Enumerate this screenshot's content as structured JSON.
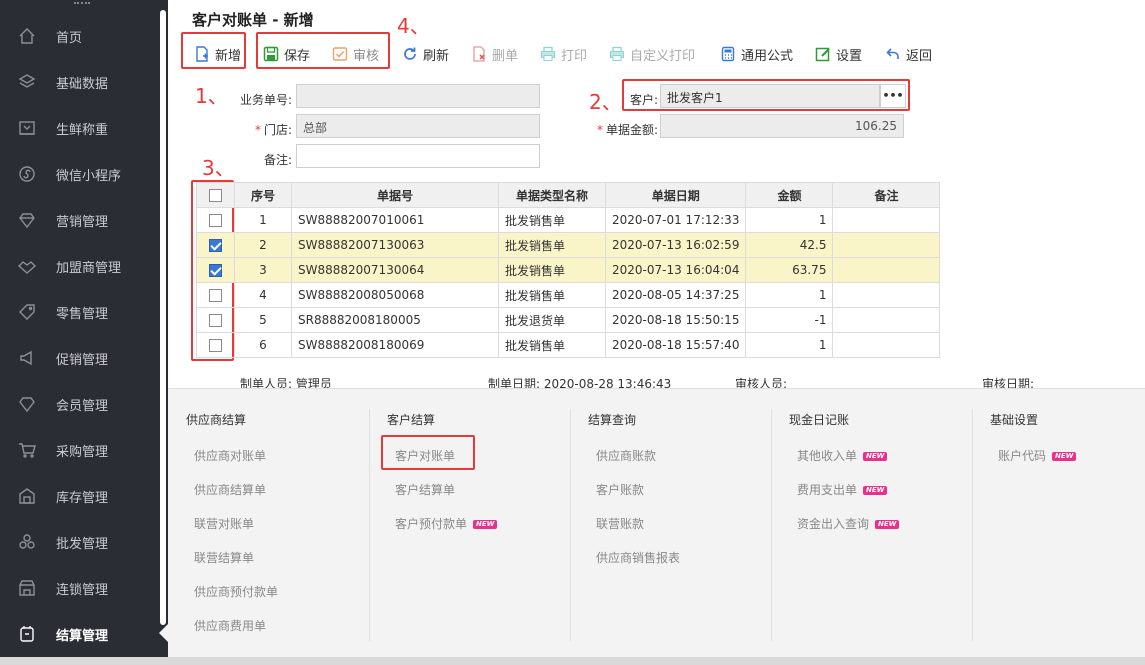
{
  "sidebar": {
    "items": [
      {
        "label": "首页",
        "icon": "home-icon"
      },
      {
        "label": "基础数据",
        "icon": "layers-icon"
      },
      {
        "label": "生鲜称重",
        "icon": "scale-icon"
      },
      {
        "label": "微信小程序",
        "icon": "miniprogram-icon"
      },
      {
        "label": "营销管理",
        "icon": "diamond-icon"
      },
      {
        "label": "加盟商管理",
        "icon": "handshake-icon"
      },
      {
        "label": "零售管理",
        "icon": "tag-icon"
      },
      {
        "label": "促销管理",
        "icon": "megaphone-icon"
      },
      {
        "label": "会员管理",
        "icon": "vip-icon"
      },
      {
        "label": "采购管理",
        "icon": "cart-icon"
      },
      {
        "label": "库存管理",
        "icon": "warehouse-icon"
      },
      {
        "label": "批发管理",
        "icon": "boxes-icon"
      },
      {
        "label": "连锁管理",
        "icon": "store-icon"
      },
      {
        "label": "结算管理",
        "icon": "wallet-icon",
        "active": true
      }
    ]
  },
  "page": {
    "title": "客户对账单 - 新增"
  },
  "toolbar": {
    "new": "新增",
    "save": "保存",
    "audit": "审核",
    "refresh": "刷新",
    "delete": "删单",
    "print": "打印",
    "custom_print": "自定义打印",
    "formula": "通用公式",
    "settings": "设置",
    "back": "返回"
  },
  "form": {
    "doc_no_label": "业务单号:",
    "doc_no_value": "",
    "store_label": "门店:",
    "store_value": "总部",
    "remark_label": "备注:",
    "remark_value": "",
    "customer_label": "客户:",
    "customer_value": "批发客户1",
    "customer_btn": "•••",
    "amount_label": "单据金额:",
    "amount_value": "106.25",
    "required_mark": "*"
  },
  "annotations": [
    "1、",
    "2、",
    "3、",
    "4、"
  ],
  "grid": {
    "columns": [
      "序号",
      "单据号",
      "单据类型名称",
      "单据日期",
      "金额",
      "备注"
    ],
    "rows": [
      {
        "checked": false,
        "seq": "1",
        "doc": "SW88882007010061",
        "type": "批发销售单",
        "date": "2020-07-01 17:12:33",
        "amount": "1",
        "remark": ""
      },
      {
        "checked": true,
        "seq": "2",
        "doc": "SW88882007130063",
        "type": "批发销售单",
        "date": "2020-07-13 16:02:59",
        "amount": "42.5",
        "remark": ""
      },
      {
        "checked": true,
        "seq": "3",
        "doc": "SW88882007130064",
        "type": "批发销售单",
        "date": "2020-07-13 16:04:04",
        "amount": "63.75",
        "remark": ""
      },
      {
        "checked": false,
        "seq": "4",
        "doc": "SW88882008050068",
        "type": "批发销售单",
        "date": "2020-08-05 14:37:25",
        "amount": "1",
        "remark": ""
      },
      {
        "checked": false,
        "seq": "5",
        "doc": "SR88882008180005",
        "type": "批发退货单",
        "date": "2020-08-18 15:50:15",
        "amount": "-1",
        "remark": ""
      },
      {
        "checked": false,
        "seq": "6",
        "doc": "SW88882008180069",
        "type": "批发销售单",
        "date": "2020-08-18 15:57:40",
        "amount": "1",
        "remark": ""
      }
    ]
  },
  "footer": {
    "maker": "制单人员: 管理员",
    "make_date": "制单日期: 2020-08-28 13:46:43",
    "auditor": "审核人员:",
    "audit_date": "审核日期:"
  },
  "menu": {
    "badge": "NEW",
    "columns": [
      {
        "title": "供应商结算",
        "links": [
          {
            "label": "供应商对账单"
          },
          {
            "label": "供应商结算单"
          },
          {
            "label": "联营对账单"
          },
          {
            "label": "联营结算单"
          },
          {
            "label": "供应商预付款单"
          },
          {
            "label": "供应商费用单"
          }
        ]
      },
      {
        "title": "客户结算",
        "links": [
          {
            "label": "客户对账单",
            "highlight": true
          },
          {
            "label": "客户结算单"
          },
          {
            "label": "客户预付款单",
            "new": true
          }
        ]
      },
      {
        "title": "结算查询",
        "links": [
          {
            "label": "供应商账款"
          },
          {
            "label": "客户账款"
          },
          {
            "label": "联营账款"
          },
          {
            "label": "供应商销售报表"
          }
        ]
      },
      {
        "title": "现金日记账",
        "links": [
          {
            "label": "其他收入单",
            "new": true
          },
          {
            "label": "费用支出单",
            "new": true
          },
          {
            "label": "资金出入查询",
            "new": true
          }
        ]
      },
      {
        "title": "基础设置",
        "links": [
          {
            "label": "账户代码",
            "new": true
          }
        ]
      }
    ]
  },
  "colors": {
    "sidebar_bg": "#2a2d33",
    "annotation_red": "#e53a3a",
    "selected_row": "#faf5c8",
    "new_badge": "#e8318c"
  }
}
